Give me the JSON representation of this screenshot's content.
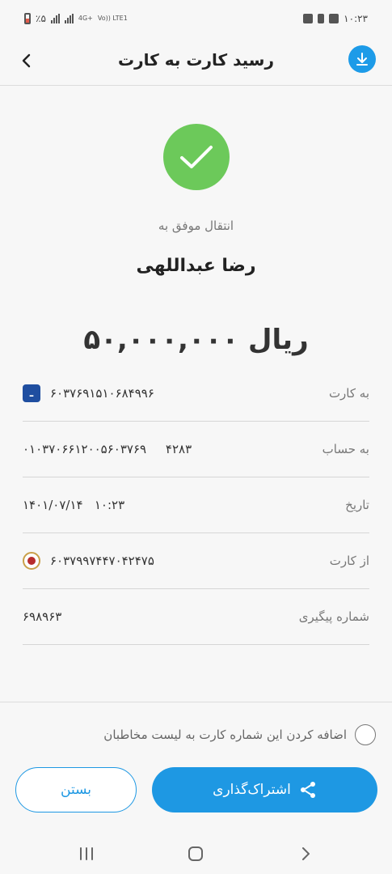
{
  "status_bar": {
    "battery": "٪۵",
    "network": "4G+",
    "volte": "Vo)) LTE1",
    "time": "۱۰:۲۳"
  },
  "header": {
    "title": "رسید کارت به کارت",
    "back_icon": "chevron-left-icon",
    "download_icon": "download-icon"
  },
  "receipt": {
    "status_icon": "checkmark-icon",
    "transfer_label": "انتقال موفق به",
    "recipient_name": "رضا عبداللهی",
    "amount": "۵۰,۰۰۰,۰۰۰ ریال"
  },
  "details": [
    {
      "label": "به کارت",
      "value": "۶۰۳۷۶۹۱۵۱۰۶۸۴۹۹۶",
      "icon": "bank-saderat-icon"
    },
    {
      "label": "به حساب",
      "value": "۴۲۸۳     ۰۱۰۳۷۰۶۶۱۲۰۰۵۶۰۳۷۶۹",
      "icon": ""
    },
    {
      "label": "تاریخ",
      "value": "۱۰:۲۳   ۱۴۰۱/۰۷/۱۴",
      "icon": ""
    },
    {
      "label": "از کارت",
      "value": "۶۰۳۷۹۹۷۴۴۷۰۴۲۴۷۵",
      "icon": "bank-melli-icon"
    },
    {
      "label": "شماره پیگیری",
      "value": "۶۹۸۹۶۳",
      "icon": ""
    }
  ],
  "add_contact": {
    "label": "اضافه کردن این شماره کارت به لیست مخاطبان",
    "checked": false
  },
  "actions": {
    "share_label": "اشتراک‌گذاری",
    "close_label": "بستن"
  },
  "colors": {
    "accent": "#1e98e3",
    "success": "#6cc95a"
  }
}
